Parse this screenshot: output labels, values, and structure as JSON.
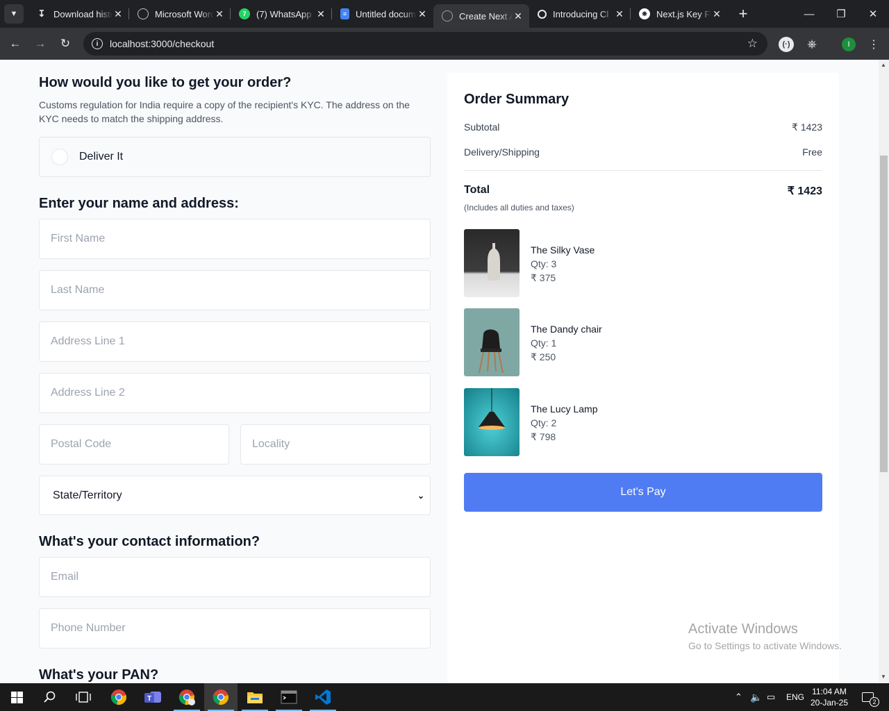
{
  "browser": {
    "tabs": [
      {
        "title": "Download histo",
        "icon": "download-icon"
      },
      {
        "title": "Microsoft Word",
        "icon": "globe-icon"
      },
      {
        "title": "(7) WhatsApp",
        "icon": "whatsapp-icon"
      },
      {
        "title": "Untitled docum",
        "icon": "docs-icon"
      },
      {
        "title": "Create Next Ap",
        "icon": "globe-icon"
      },
      {
        "title": "Introducing Cl",
        "icon": "openai-icon"
      },
      {
        "title": "Next.js Key Fe",
        "icon": "openai-icon"
      }
    ],
    "url": "localhost:3000/checkout",
    "profile_initial": "I"
  },
  "delivery": {
    "heading": "How would you like to get your order?",
    "description": "Customs regulation for India require a copy of the recipient's KYC. The address on the KYC needs to match the shipping address.",
    "option": "Deliver It"
  },
  "address": {
    "heading": "Enter your name and address:",
    "first_name": "First Name",
    "last_name": "Last Name",
    "line1": "Address Line 1",
    "line2": "Address Line 2",
    "postal": "Postal Code",
    "locality": "Locality",
    "state": "State/Territory"
  },
  "contact": {
    "heading": "What's your contact information?",
    "email": "Email",
    "phone": "Phone Number"
  },
  "pan": {
    "heading": "What's your PAN?"
  },
  "summary": {
    "title": "Order Summary",
    "subtotal_label": "Subtotal",
    "subtotal_value": "₹ 1423",
    "shipping_label": "Delivery/Shipping",
    "shipping_value": "Free",
    "total_label": "Total",
    "total_value": "₹ 1423",
    "total_note": "(Includes all duties and taxes)",
    "items": [
      {
        "name": "The Silky Vase",
        "qty": "Qty: 3",
        "price": "₹ 375"
      },
      {
        "name": "The Dandy chair",
        "qty": "Qty: 1",
        "price": "₹ 250"
      },
      {
        "name": "The Lucy Lamp",
        "qty": "Qty: 2",
        "price": "₹ 798"
      }
    ],
    "pay_label": "Let's Pay"
  },
  "watermark": {
    "title": "Activate Windows",
    "subtitle": "Go to Settings to activate Windows."
  },
  "taskbar": {
    "language": "ENG",
    "time": "11:04 AM",
    "date": "20-Jan-25",
    "notification_count": "2"
  }
}
